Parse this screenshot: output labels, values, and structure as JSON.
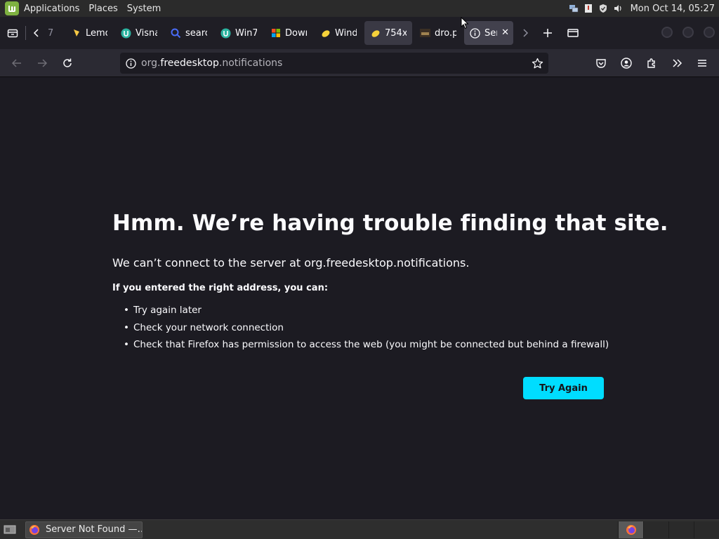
{
  "desktop_panel": {
    "menu": [
      "Applications",
      "Places",
      "System"
    ],
    "clock": "Mon Oct 14, 05:27",
    "tray_icons": [
      "network-icon",
      "clipboard-icon",
      "shield-icon",
      "volume-icon"
    ]
  },
  "tabs": [
    {
      "label": "7",
      "icon": "overflow-tab"
    },
    {
      "label": "Lemon",
      "icon": "lemon-icon"
    },
    {
      "label": "Visnav",
      "icon": "u-icon"
    },
    {
      "label": "search",
      "icon": "search-icon"
    },
    {
      "label": "Win7",
      "icon": "u-icon"
    },
    {
      "label": "Download",
      "icon": "windows-icon"
    },
    {
      "label": "Windows",
      "icon": "lemon-icon"
    },
    {
      "label": "754x",
      "icon": "lemon-icon"
    },
    {
      "label": "dro.p",
      "icon": "image-icon"
    },
    {
      "label": "Server",
      "icon": "info-icon"
    }
  ],
  "urlbar": {
    "domain_prefix": "org.",
    "domain_main": "freedesktop",
    "domain_suffix": ".notifications"
  },
  "error_page": {
    "title": "Hmm. We’re having trouble finding that site.",
    "description": "We can’t connect to the server at org.freedesktop.notifications.",
    "subtitle": "If you entered the right address, you can:",
    "suggestions": [
      "Try again later",
      "Check your network connection",
      "Check that Firefox has permission to access the web (you might be connected but behind a firewall)"
    ],
    "button_label": "Try Again"
  },
  "taskbar": {
    "window_title": "Server Not Found —…"
  },
  "colors": {
    "page_bg": "#1c1b22",
    "accent_button": "#00ddff",
    "toolbar": "#2b2a33",
    "mint_green": "#7fb241"
  }
}
